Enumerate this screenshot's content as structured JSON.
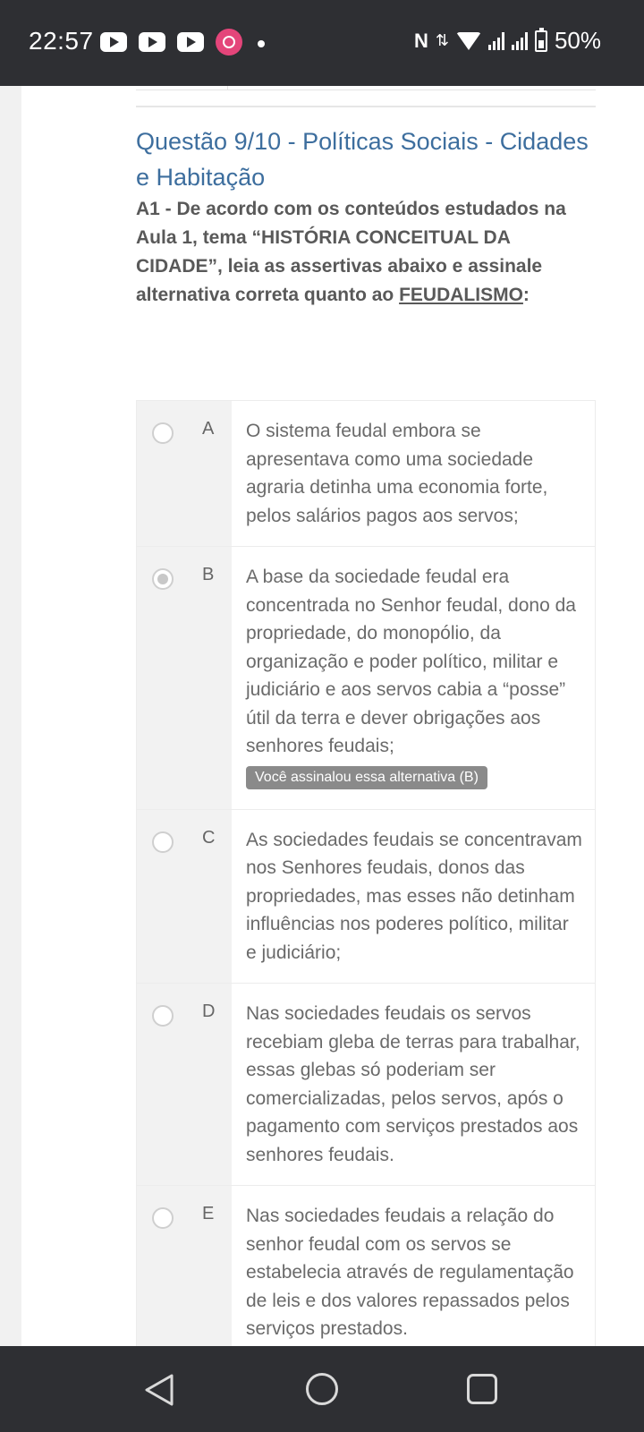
{
  "status_bar": {
    "time": "22:57",
    "battery": "50%",
    "icons": [
      "youtube-icon",
      "youtube-icon",
      "youtube-icon",
      "camera-app-icon",
      "dot-icon",
      "nfc-icon",
      "data-arrows-icon",
      "wifi-icon",
      "signal-icon",
      "signal-icon",
      "battery-icon"
    ]
  },
  "question": {
    "title": "Questão 9/10 - Políticas Sociais - Cidades e Habitação",
    "text_prefix": "A1 - De acordo com os conteúdos estudados na Aula 1, tema “HISTÓRIA CONCEITUAL DA CIDADE”, leia as assertivas abaixo e assinale alternativa correta quanto ao ",
    "text_underlined": "FEUDALISMO",
    "text_suffix": ":"
  },
  "options": [
    {
      "letter": "A",
      "text": "O sistema feudal embora se apresentava como uma sociedade agraria detinha uma economia forte, pelos salários pagos aos servos;",
      "selected": false
    },
    {
      "letter": "B",
      "text": "A base da sociedade feudal era concentrada no Senhor feudal, dono da propriedade, do monopólio, da organização e poder político, militar e judiciário e aos servos cabia a “posse” útil da terra e dever obrigações aos senhores feudais;",
      "selected": true,
      "badge": "Você assinalou essa alternativa (B)"
    },
    {
      "letter": "C",
      "text": "As sociedades feudais se concentravam nos Senhores feudais, donos das propriedades, mas esses não detinham influências nos poderes político, militar e judiciário;",
      "selected": false
    },
    {
      "letter": "D",
      "text": "Nas sociedades feudais os servos recebiam gleba de terras para trabalhar, essas glebas só poderiam ser comercializadas, pelos servos, após o pagamento com serviços prestados aos senhores feudais.",
      "selected": false
    },
    {
      "letter": "E",
      "text": "Nas sociedades feudais a relação do senhor feudal com os servos se estabelecia através de regulamentação de leis e dos valores repassados pelos serviços prestados.",
      "selected": false
    }
  ],
  "nav_bar": {
    "icons": [
      "back-icon",
      "home-icon",
      "recent-apps-icon"
    ]
  },
  "colors": {
    "title_blue": "#3d6e9e",
    "system_bar": "#2e2f33"
  }
}
